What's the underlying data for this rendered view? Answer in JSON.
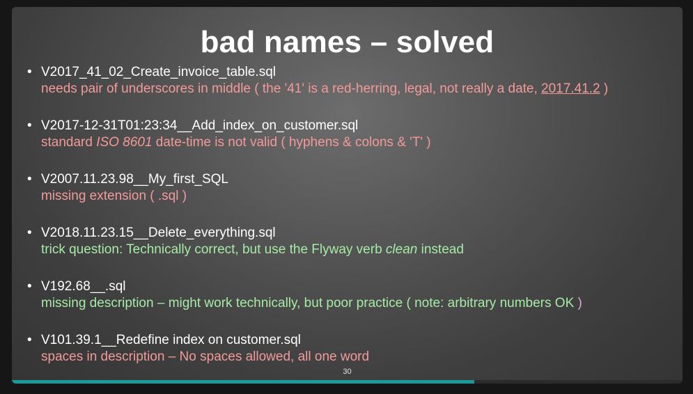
{
  "slide": {
    "title": "bad names – solved",
    "page_number": "30",
    "progress": 0.69,
    "colors": {
      "error_note": "#f39a9a",
      "ok_note": "#a6eba6",
      "progress": "#1a9a9a"
    },
    "items": [
      {
        "filename": "V2017_41_02_Create_invoice_table.sql",
        "note_a": "needs pair of underscores in middle ( the '41' is a red-herring, legal, not really a date, ",
        "note_link": "2017.41.2",
        "note_b": " )"
      },
      {
        "filename": "V2017-12-31T01:23:34__Add_index_on_customer.sql",
        "note_a": "standard ",
        "note_em": "ISO 8601",
        "note_b": " date-time is not valid ( hyphens & colons & 'T' )"
      },
      {
        "filename": "V2007.11.23.98__My_first_SQL",
        "note": "missing extension ( .sql )"
      },
      {
        "filename": "V2018.11.23.15__Delete_everything.sql",
        "note_a": "trick question: Technically correct, but use the Flyway verb ",
        "note_em": "clean",
        "note_b": " instead"
      },
      {
        "filename": "V192.68__.sql",
        "note_a": "missing description – might work technically, but poor practice ( note: arbitrary numbers OK ",
        "note_b": ")"
      },
      {
        "filename": "V101.39.1__Redefine index on customer.sql",
        "note": "spaces in description – No spaces allowed, all one word"
      }
    ]
  }
}
